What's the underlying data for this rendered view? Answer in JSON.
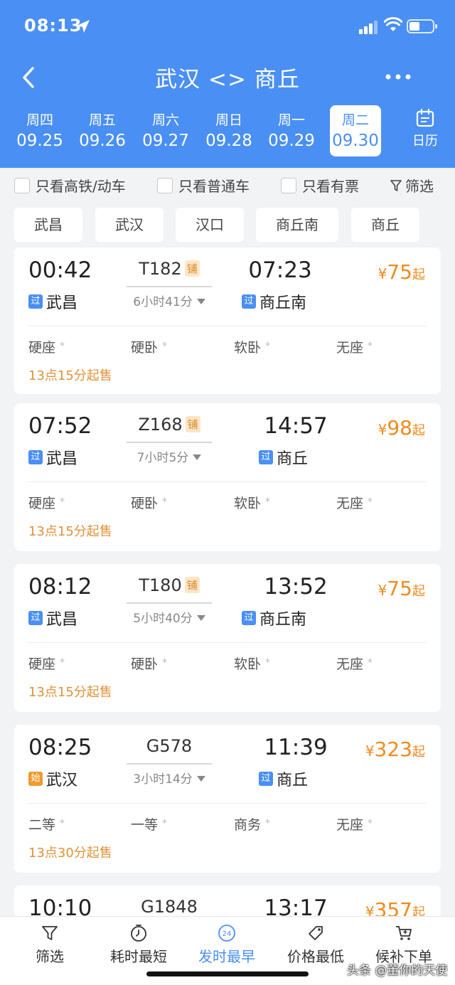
{
  "status_bar": {
    "time": "08:13"
  },
  "nav": {
    "title": "武汉 <> 商丘"
  },
  "dates": [
    {
      "weekday": "周四",
      "date": "09.25",
      "selected": false
    },
    {
      "weekday": "周五",
      "date": "09.26",
      "selected": false
    },
    {
      "weekday": "周六",
      "date": "09.27",
      "selected": false
    },
    {
      "weekday": "周日",
      "date": "09.28",
      "selected": false
    },
    {
      "weekday": "周一",
      "date": "09.29",
      "selected": false
    },
    {
      "weekday": "周二",
      "date": "09.30",
      "selected": true
    }
  ],
  "calendar_label": "日历",
  "filters": {
    "high_speed_only": "只看高铁/动车",
    "normal_only": "只看普通车",
    "tickets_only": "只看有票",
    "filter_label": "筛选"
  },
  "stations": [
    "武昌",
    "武汉",
    "汉口",
    "商丘南",
    "商丘"
  ],
  "trains": [
    {
      "dep_time": "00:42",
      "train_no": "T182",
      "berth_tag": "铺",
      "duration": "6小时41分",
      "arr_time": "07:23",
      "price": "75",
      "dep_tag": "过",
      "dep_station": "武昌",
      "arr_tag": "过",
      "arr_station": "商丘南",
      "seats": [
        "硬座",
        "硬卧",
        "软卧",
        "无座"
      ],
      "sale_time": "13点15分起售"
    },
    {
      "dep_time": "07:52",
      "train_no": "Z168",
      "berth_tag": "铺",
      "duration": "7小时5分",
      "arr_time": "14:57",
      "price": "98",
      "dep_tag": "过",
      "dep_station": "武昌",
      "arr_tag": "过",
      "arr_station": "商丘",
      "seats": [
        "硬座",
        "硬卧",
        "软卧",
        "无座"
      ],
      "sale_time": "13点15分起售"
    },
    {
      "dep_time": "08:12",
      "train_no": "T180",
      "berth_tag": "铺",
      "duration": "5小时40分",
      "arr_time": "13:52",
      "price": "75",
      "dep_tag": "过",
      "dep_station": "武昌",
      "arr_tag": "过",
      "arr_station": "商丘南",
      "seats": [
        "硬座",
        "硬卧",
        "软卧",
        "无座"
      ],
      "sale_time": "13点15分起售"
    },
    {
      "dep_time": "08:25",
      "train_no": "G578",
      "berth_tag": "",
      "duration": "3小时14分",
      "arr_time": "11:39",
      "price": "323",
      "dep_tag": "始",
      "dep_station": "武汉",
      "arr_tag": "过",
      "arr_station": "商丘",
      "seats": [
        "二等",
        "一等",
        "商务",
        "无座"
      ],
      "sale_time": "13点30分起售"
    },
    {
      "dep_time": "10:10",
      "train_no": "G1848",
      "berth_tag": "",
      "duration": "",
      "arr_time": "13:17",
      "price": "357",
      "dep_tag": "",
      "dep_station": "",
      "arr_tag": "",
      "arr_station": "",
      "seats": [],
      "sale_time": ""
    }
  ],
  "price_symbol": "¥",
  "price_suffix": "起",
  "bottom_tabs": [
    {
      "label": "筛选",
      "icon": "funnel-icon",
      "active": false
    },
    {
      "label": "耗时最短",
      "icon": "timer-icon",
      "active": false
    },
    {
      "label": "发时最早",
      "icon": "clock-24-icon",
      "active": true
    },
    {
      "label": "价格最低",
      "icon": "price-tag-icon",
      "active": false
    },
    {
      "label": "候补下单",
      "icon": "cart-icon",
      "active": false
    }
  ],
  "clock_24_text": "24",
  "watermark": "头条 @董你的天使",
  "colors": {
    "primary": "#4a8ff3",
    "price": "#f08a1e",
    "sale": "#e0923a",
    "start_tag": "#f09a2e"
  }
}
